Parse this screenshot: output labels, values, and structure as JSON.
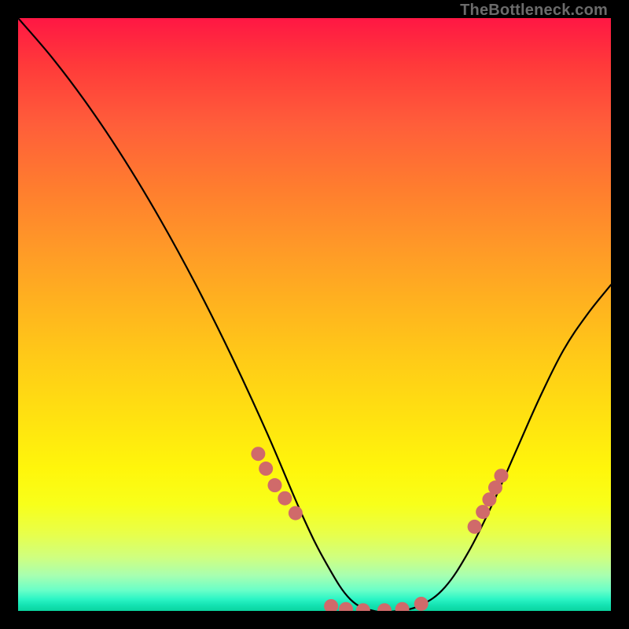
{
  "attribution": "TheBottleneck.com",
  "chart_data": {
    "type": "line",
    "title": "",
    "xlabel": "",
    "ylabel": "",
    "xlim": [
      0,
      100
    ],
    "ylim": [
      0,
      100
    ],
    "gradient_colors": {
      "top": "#ff1744",
      "mid": "#ffe310",
      "bottom": "#0ad49f"
    },
    "series": [
      {
        "name": "curve",
        "color": "#000000",
        "x": [
          0,
          6,
          12,
          18,
          24,
          30,
          36,
          42,
          48,
          52,
          56,
          60,
          64,
          68,
          72,
          76,
          80,
          84,
          88,
          92,
          96,
          100
        ],
        "y": [
          100,
          93,
          85,
          76,
          66,
          55,
          43,
          30,
          16,
          8,
          2,
          0,
          0,
          1,
          4,
          10,
          18,
          27,
          36,
          44,
          50,
          55
        ]
      }
    ],
    "markers": {
      "name": "dots",
      "color": "#d06a6a",
      "radius_px": 9,
      "points": [
        {
          "x": 40.5,
          "y": 26.5
        },
        {
          "x": 41.8,
          "y": 24.0
        },
        {
          "x": 43.3,
          "y": 21.2
        },
        {
          "x": 45.0,
          "y": 19.0
        },
        {
          "x": 46.8,
          "y": 16.5
        },
        {
          "x": 52.8,
          "y": 0.8
        },
        {
          "x": 55.3,
          "y": 0.3
        },
        {
          "x": 58.2,
          "y": 0.1
        },
        {
          "x": 61.8,
          "y": 0.1
        },
        {
          "x": 64.8,
          "y": 0.3
        },
        {
          "x": 68.0,
          "y": 1.2
        },
        {
          "x": 77.0,
          "y": 14.2
        },
        {
          "x": 78.4,
          "y": 16.7
        },
        {
          "x": 79.5,
          "y": 18.8
        },
        {
          "x": 80.5,
          "y": 20.8
        },
        {
          "x": 81.5,
          "y": 22.8
        }
      ]
    }
  }
}
